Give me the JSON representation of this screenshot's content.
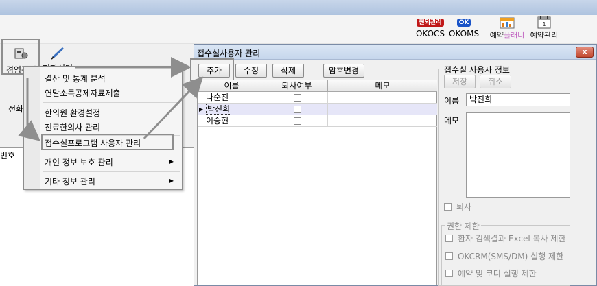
{
  "toolbar": {
    "okocs_logo": "원외관리",
    "okocs_label": "OKOCS",
    "okoms_logo": "OK",
    "okoms_label": "OKOMS",
    "planner_label_a": "예약",
    "planner_label_b": "플래너",
    "reservation_label": "예약관리"
  },
  "left": {
    "mgmt_label": "경영관리",
    "doc_label": "전자서면",
    "phone_label": "전화",
    "num_label": "번호"
  },
  "menu": {
    "items": [
      "결산 및 통계 분석",
      "연말소득공제자료제출",
      "한의원 환경설정",
      "진료한의사 관리",
      "접수실프로그램 사용자 관리",
      "개인 정보 보호 관리",
      "기타 정보 관리"
    ]
  },
  "dialog": {
    "title": "접수실사용자 관리",
    "close": "x",
    "buttons": {
      "add": "추가",
      "edit": "수정",
      "delete": "삭제",
      "password": "암호변경"
    },
    "columns": [
      "이름",
      "퇴사여부",
      "메모"
    ],
    "rows": [
      {
        "name": "나순진",
        "retired": false,
        "memo": ""
      },
      {
        "name": "박진희",
        "retired": false,
        "memo": "",
        "selected": true
      },
      {
        "name": "이승현",
        "retired": false,
        "memo": ""
      }
    ],
    "info": {
      "group_title": "접수실 사용자 정보",
      "save": "저장",
      "cancel": "취소",
      "name_label": "이름",
      "name_value": "박진희",
      "memo_label": "메모",
      "retire_label": "퇴사",
      "perm_title": "권한 제한",
      "perm1": "환자 검색결과 Excel 복사 제한",
      "perm2": "OKCRM(SMS/DM) 실행 제한",
      "perm3": "예약 및 코디 실행 제한"
    }
  }
}
